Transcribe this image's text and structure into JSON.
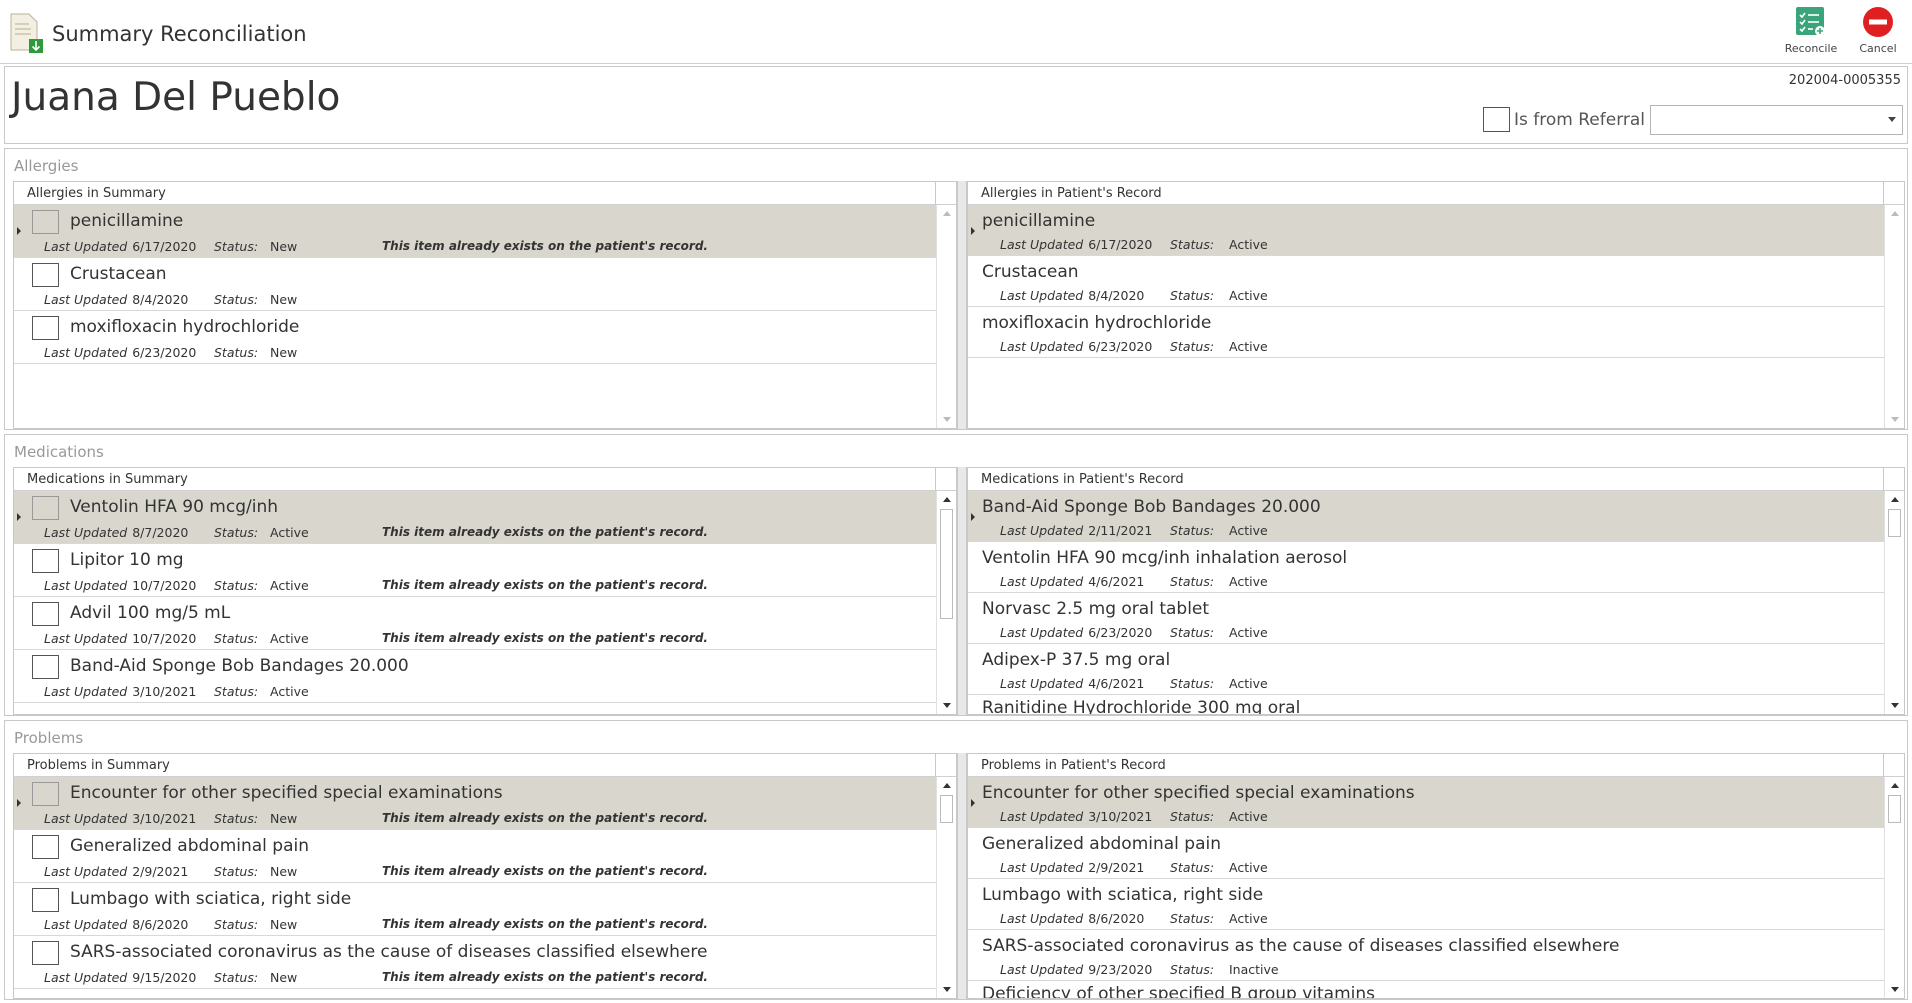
{
  "app": {
    "title": "Summary Reconciliation"
  },
  "toolbar": {
    "reconcile_label": "Reconcile",
    "cancel_label": "Cancel"
  },
  "patient": {
    "name": "Juana Del Pueblo",
    "id": "202004-0005355",
    "referral_label": "Is from Referral",
    "referral_value": ""
  },
  "labels": {
    "last_updated": "Last Updated",
    "status": "Status:",
    "exists": "This item already exists on the patient's record."
  },
  "allergies": {
    "title": "Allergies",
    "summary_header": "Allergies in Summary",
    "record_header": "Allergies in Patient's Record",
    "summary": [
      {
        "name": "penicillamine",
        "updated": "6/17/2020",
        "status": "New",
        "exists": true
      },
      {
        "name": "Crustacean",
        "updated": "8/4/2020",
        "status": "New",
        "exists": false
      },
      {
        "name": "moxifloxacin hydrochloride",
        "updated": "6/23/2020",
        "status": "New",
        "exists": false
      }
    ],
    "record": [
      {
        "name": "penicillamine",
        "updated": "6/17/2020",
        "status": "Active"
      },
      {
        "name": "Crustacean",
        "updated": "8/4/2020",
        "status": "Active"
      },
      {
        "name": "moxifloxacin hydrochloride",
        "updated": "6/23/2020",
        "status": "Active"
      }
    ]
  },
  "medications": {
    "title": "Medications",
    "summary_header": "Medications in Summary",
    "record_header": "Medications in Patient's Record",
    "summary": [
      {
        "name": "Ventolin HFA 90 mcg/inh",
        "updated": "8/7/2020",
        "status": "Active",
        "exists": true
      },
      {
        "name": "Lipitor 10 mg",
        "updated": "10/7/2020",
        "status": "Active",
        "exists": true
      },
      {
        "name": "Advil 100 mg/5 mL",
        "updated": "10/7/2020",
        "status": "Active",
        "exists": true
      },
      {
        "name": "Band-Aid Sponge Bob Bandages 20.000",
        "updated": "3/10/2021",
        "status": "Active",
        "exists": false
      }
    ],
    "record": [
      {
        "name": "Band-Aid Sponge Bob Bandages 20.000",
        "updated": "2/11/2021",
        "status": "Active"
      },
      {
        "name": "Ventolin HFA 90 mcg/inh inhalation aerosol",
        "updated": "4/6/2021",
        "status": "Active"
      },
      {
        "name": "Norvasc 2.5 mg oral tablet",
        "updated": "6/23/2020",
        "status": "Active"
      },
      {
        "name": "Adipex-P 37.5 mg oral",
        "updated": "4/6/2021",
        "status": "Active"
      }
    ],
    "record_cut": "Ranitidine Hydrochloride 300 mg oral"
  },
  "problems": {
    "title": "Problems",
    "summary_header": "Problems in Summary",
    "record_header": "Problems in Patient's Record",
    "summary": [
      {
        "name": "Encounter for other specified special examinations",
        "updated": "3/10/2021",
        "status": "New",
        "exists": true
      },
      {
        "name": "Generalized abdominal pain",
        "updated": "2/9/2021",
        "status": "New",
        "exists": true
      },
      {
        "name": "Lumbago with sciatica, right side",
        "updated": "8/6/2020",
        "status": "New",
        "exists": true
      },
      {
        "name": "SARS-associated coronavirus as the cause of diseases classified elsewhere",
        "updated": "9/15/2020",
        "status": "New",
        "exists": true
      }
    ],
    "record": [
      {
        "name": "Encounter for other specified special examinations",
        "updated": "3/10/2021",
        "status": "Active"
      },
      {
        "name": "Generalized abdominal pain",
        "updated": "2/9/2021",
        "status": "Active"
      },
      {
        "name": "Lumbago with sciatica, right side",
        "updated": "8/6/2020",
        "status": "Active"
      },
      {
        "name": "SARS-associated coronavirus as the cause of diseases classified elsewhere",
        "updated": "9/23/2020",
        "status": "Inactive"
      }
    ],
    "record_cut": "Deficiency of other specified B group vitamins"
  },
  "colors": {
    "selected_row": "#d8d6cd",
    "reconcile_accent": "#3aa57a",
    "cancel_accent": "#e02020"
  }
}
